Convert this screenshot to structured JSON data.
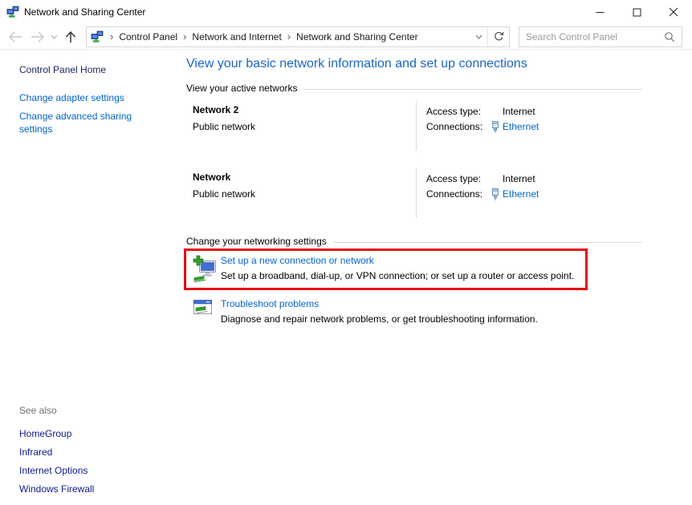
{
  "colors": {
    "highlight": "#e60d0d",
    "link": "#0066cc",
    "heading": "#1a66c4",
    "navy_link": "#19235f",
    "see_also_link": "#0d1a89"
  },
  "window": {
    "title": "Network and Sharing Center"
  },
  "toolbar": {
    "breadcrumb": [
      "Control Panel",
      "Network and Internet",
      "Network and Sharing Center"
    ],
    "separator": "›",
    "search_placeholder": "Search Control Panel"
  },
  "sidebar": {
    "home": "Control Panel Home",
    "tasks": [
      "Change adapter settings",
      "Change advanced sharing settings"
    ],
    "see_also": {
      "header": "See also",
      "links": [
        "HomeGroup",
        "Infrared",
        "Internet Options",
        "Windows Firewall"
      ]
    }
  },
  "main": {
    "heading": "View your basic network information and set up connections",
    "active_networks_header": "View your active networks",
    "networks": [
      {
        "name": "Network 2",
        "profile": "Public network",
        "access_label": "Access type:",
        "access_value": "Internet",
        "connections_label": "Connections:",
        "connection": "Ethernet"
      },
      {
        "name": "Network",
        "profile": "Public network",
        "access_label": "Access type:",
        "access_value": "Internet",
        "connections_label": "Connections:",
        "connection": "Ethernet"
      }
    ],
    "settings_header": "Change your networking settings",
    "settings": [
      {
        "title": "Set up a new connection or network",
        "description": "Set up a broadband, dial-up, or VPN connection; or set up a router or access point."
      },
      {
        "title": "Troubleshoot problems",
        "description": "Diagnose and repair network problems, or get troubleshooting information."
      }
    ]
  },
  "icons": {
    "app": "network-computers",
    "nav_back": "arrow-left",
    "nav_forward": "arrow-right",
    "recent_pages": "chevron-down",
    "nav_up": "arrow-up",
    "address_dropdown": "chevron-down",
    "refresh": "circular-arrow",
    "search": "magnifier",
    "ethernet": "ethernet-plug",
    "setup_connection": "monitor-with-green-plus",
    "troubleshoot": "window-with-green-bar",
    "minimize": "line",
    "maximize": "square",
    "close": "x"
  }
}
